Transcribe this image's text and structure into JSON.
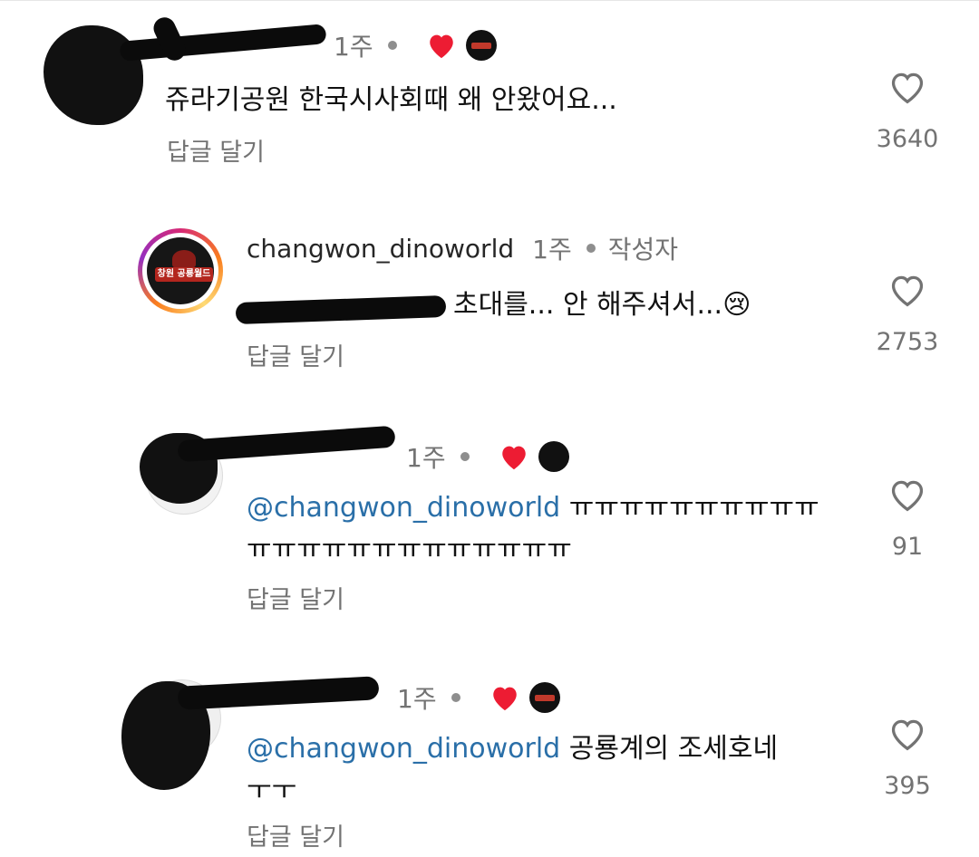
{
  "comments": [
    {
      "time": "1주",
      "text": "쥬라기공원 한국시사회때 왜 안왔어요...",
      "reply_label": "답글 달기",
      "like_count": "3640"
    },
    {
      "username": "changwon_dinoworld",
      "time": "1주",
      "author_tag": "작성자",
      "text": "초대를... 안 해주셔서...😢",
      "reply_label": "답글 달기",
      "like_count": "2753",
      "logo_label": "창원 공룡월드"
    },
    {
      "time": "1주",
      "mention": "@changwon_dinoworld",
      "text_line1": "ㅠㅠㅠㅠㅠㅠㅠㅠㅠㅠ",
      "text_line2": "ㅠㅠㅠㅠㅠㅠㅠㅠㅠㅠㅠㅠㅠ",
      "reply_label": "답글 달기",
      "like_count": "91"
    },
    {
      "time": "1주",
      "mention": "@changwon_dinoworld",
      "text_line1": "공룡계의 조세호네",
      "text_line2": "ㅜㅜ",
      "reply_label": "답글 달기",
      "like_count": "395"
    }
  ],
  "colors": {
    "mention": "#2a6fa8",
    "liked_heart": "#ed1c33",
    "muted_text": "#737373"
  },
  "icons": {
    "like": "heart-outline-icon",
    "author_liked": "heart-filled-icon"
  }
}
